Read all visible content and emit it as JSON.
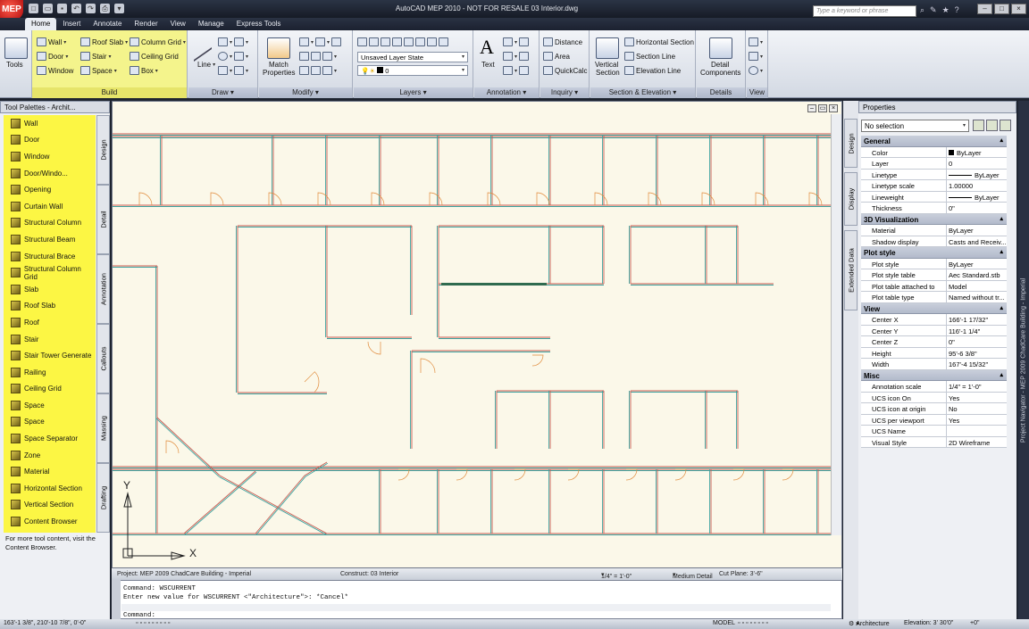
{
  "window": {
    "title": "AutoCAD MEP 2010 - NOT FOR RESALE    03 Interior.dwg",
    "search_placeholder": "Type a keyword or phrase",
    "app_button": "MEP"
  },
  "tabs": [
    "Home",
    "Insert",
    "Annotate",
    "Render",
    "View",
    "Manage",
    "Express Tools"
  ],
  "ribbon": {
    "tools_label": "Tools",
    "build": {
      "title": "Build",
      "items": [
        "Wall",
        "Door",
        "Window",
        "Roof Slab",
        "Stair",
        "Space",
        "Column Grid",
        "Ceiling Grid",
        "Box"
      ]
    },
    "draw": {
      "title": "Draw",
      "line": "Line"
    },
    "modify": {
      "title": "Modify",
      "match": "Match",
      "properties": "Properties"
    },
    "layers": {
      "title": "Layers",
      "layer_state": "Unsaved Layer State",
      "current_layer": "0"
    },
    "annotation": {
      "title": "Annotation",
      "text": "Text"
    },
    "inquiry": {
      "title": "Inquiry",
      "items": [
        "Distance",
        "Area",
        "QuickCalc"
      ]
    },
    "section": {
      "title": "Section & Elevation",
      "vertical": "Vertical",
      "section_word": "Section",
      "items": [
        "Horizontal Section",
        "Section Line",
        "Elevation Line"
      ]
    },
    "details": {
      "title": "Details",
      "detail": "Detail",
      "components": "Components"
    },
    "view": {
      "title": "View"
    }
  },
  "palette": {
    "title": "Tool Palettes - Archit...",
    "items": [
      "Wall",
      "Door",
      "Window",
      "Door/Windo...",
      "Opening",
      "Curtain Wall",
      "Structural Column",
      "Structural Beam",
      "Structural Brace",
      "Structural Column Grid",
      "Slab",
      "Roof Slab",
      "Roof",
      "Stair",
      "Stair Tower Generate",
      "Railing",
      "Ceiling Grid",
      "Space",
      "Space",
      "Space Separator",
      "Zone",
      "Material",
      "Horizontal Section",
      "Vertical Section",
      "Content Browser"
    ],
    "note": "For more tool content, visit the Content Browser.",
    "tabs": [
      "Design",
      "Detail",
      "Annotation",
      "Callouts",
      "Massing",
      "Drafting"
    ]
  },
  "drawing": {
    "ucs_y": "Y",
    "ucs_x": "X",
    "status": {
      "project": "Project: MEP 2009 ChadCare Building - Imperial",
      "construct": "Construct: 03 Interior",
      "scale": "1/4\" = 1'-0\"",
      "detail": "Medium Detail",
      "cut_plane": "Cut Plane: 3'-6\""
    }
  },
  "command": {
    "line1": "Command: WSCURRENT",
    "line2": "Enter new value for WSCURRENT <\"Architecture\">: *Cancel*",
    "prompt": "Command:"
  },
  "statusbar": {
    "coords": "163'-1 3/8\", 210'-10 7/8\", 0'-0\"",
    "model": "MODEL",
    "workspace": "Architecture",
    "elevation": "Elevation: 3' 30'0\"",
    "offset": "+0\""
  },
  "properties": {
    "title": "Properties",
    "selection": "No selection",
    "side_tabs": [
      "Design",
      "Display",
      "Extended Data"
    ],
    "sections": [
      {
        "name": "General",
        "rows": [
          [
            "Color",
            "ByLayer"
          ],
          [
            "Layer",
            "0"
          ],
          [
            "Linetype",
            "ByLayer"
          ],
          [
            "Linetype scale",
            "1.00000"
          ],
          [
            "Lineweight",
            "ByLayer"
          ],
          [
            "Thickness",
            "0\""
          ]
        ]
      },
      {
        "name": "3D Visualization",
        "rows": [
          [
            "Material",
            "ByLayer"
          ],
          [
            "Shadow display",
            "Casts and Receiv..."
          ]
        ]
      },
      {
        "name": "Plot style",
        "rows": [
          [
            "Plot style",
            "ByLayer"
          ],
          [
            "Plot style table",
            "Aec Standard.stb"
          ],
          [
            "Plot table attached to",
            "Model"
          ],
          [
            "Plot table type",
            "Named without tr..."
          ]
        ]
      },
      {
        "name": "View",
        "rows": [
          [
            "Center X",
            "166'-1 17/32\""
          ],
          [
            "Center Y",
            "116'-1 1/4\""
          ],
          [
            "Center Z",
            "0\""
          ],
          [
            "Height",
            "95'-6 3/8\""
          ],
          [
            "Width",
            "167'-4 15/32\""
          ]
        ]
      },
      {
        "name": "Misc",
        "rows": [
          [
            "Annotation scale",
            "1/4\" = 1'-0\""
          ],
          [
            "UCS icon On",
            "Yes"
          ],
          [
            "UCS icon at origin",
            "No"
          ],
          [
            "UCS per viewport",
            "Yes"
          ],
          [
            "UCS Name",
            ""
          ],
          [
            "Visual Style",
            "2D Wireframe"
          ]
        ]
      }
    ],
    "navigator": "Project Navigator - MEP 2009 ChadCare Building - Imperial"
  },
  "colors": {
    "build_highlight": "#f4f48c",
    "palette_highlight": "#fcf644",
    "drawing_bg": "#fbf8e9",
    "wall_red": "#c85a50",
    "wall_teal": "#3fa3a0"
  }
}
